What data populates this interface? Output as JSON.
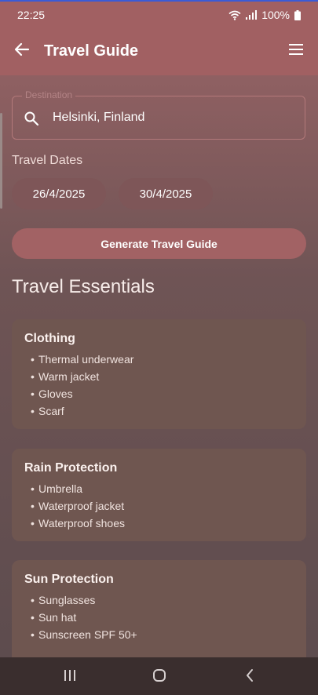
{
  "status": {
    "time": "22:25",
    "battery": "100%"
  },
  "appbar": {
    "title": "Travel Guide"
  },
  "form": {
    "destination_label": "Destination",
    "destination_value": "Helsinki, Finland",
    "dates_label": "Travel Dates",
    "start_date": "26/4/2025",
    "end_date": "30/4/2025",
    "generate_label": "Generate Travel Guide"
  },
  "essentials": {
    "title": "Travel Essentials",
    "cards": [
      {
        "title": "Clothing",
        "items": [
          "Thermal underwear",
          "Warm jacket",
          "Gloves",
          "Scarf"
        ]
      },
      {
        "title": "Rain Protection",
        "items": [
          "Umbrella",
          "Waterproof jacket",
          "Waterproof shoes"
        ]
      },
      {
        "title": "Sun Protection",
        "items": [
          "Sunglasses",
          "Sun hat",
          "Sunscreen SPF 50+"
        ]
      }
    ]
  },
  "icons": {
    "back": "arrow-left-icon",
    "menu": "hamburger-menu-icon",
    "search": "search-icon",
    "wifi": "wifi-icon",
    "signal": "signal-icon",
    "battery": "battery-icon",
    "nav_recents": "recents-icon",
    "nav_home": "home-icon",
    "nav_back": "nav-back-icon"
  },
  "colors": {
    "appbar": "#a16062",
    "button": "#a26264",
    "card": "#6f5650",
    "navbar": "#3a2e2e"
  }
}
